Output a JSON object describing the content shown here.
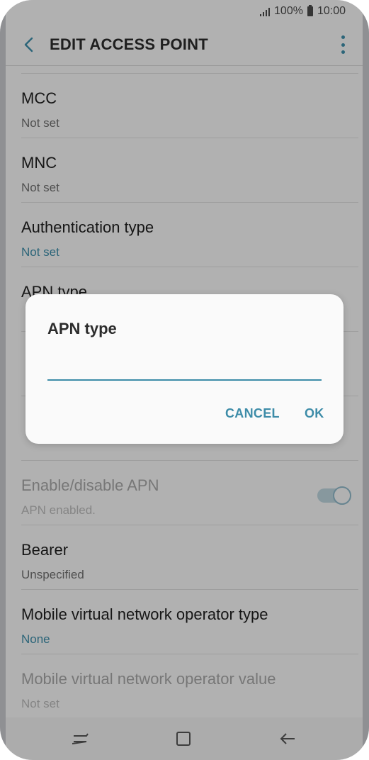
{
  "status": {
    "battery": "100%",
    "time": "10:00"
  },
  "appbar": {
    "title": "EDIT ACCESS POINT"
  },
  "rows": [
    {
      "label": "MCC",
      "value": "Not set"
    },
    {
      "label": "MNC",
      "value": "Not set"
    },
    {
      "label": "Authentication type",
      "value": "Not set"
    },
    {
      "label": "APN type",
      "value": ""
    },
    {
      "label": "",
      "value": ""
    },
    {
      "label": "",
      "value": ""
    },
    {
      "label": "Enable/disable APN",
      "value": "APN enabled."
    },
    {
      "label": "Bearer",
      "value": "Unspecified"
    },
    {
      "label": "Mobile virtual network operator type",
      "value": "None"
    },
    {
      "label": "Mobile virtual network operator value",
      "value": "Not set"
    }
  ],
  "dialog": {
    "title": "APN type",
    "input_value": "",
    "cancel_label": "CANCEL",
    "ok_label": "OK"
  },
  "colors": {
    "accent": "#3d8ca8"
  }
}
